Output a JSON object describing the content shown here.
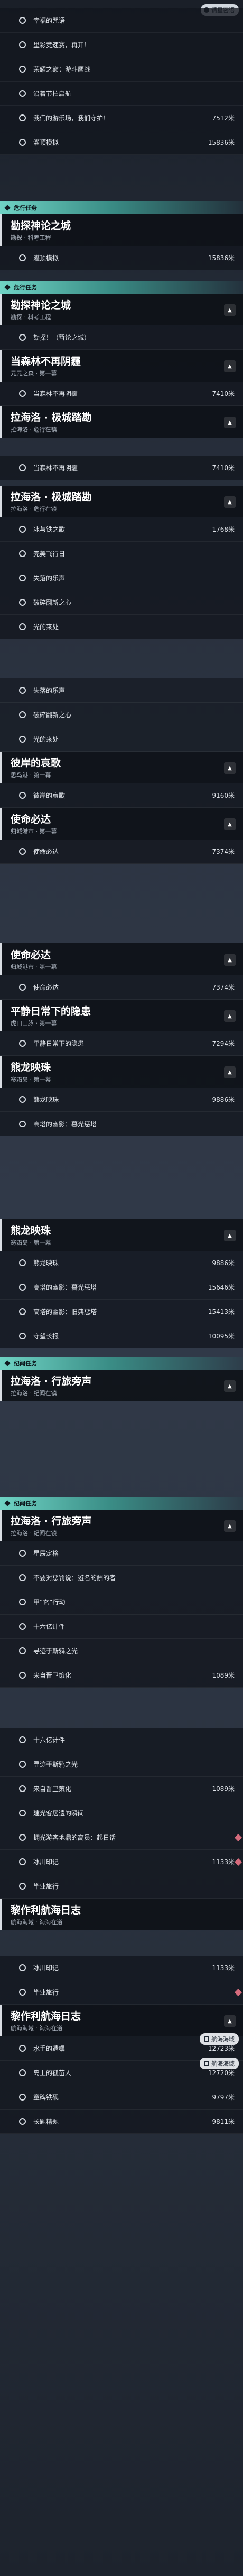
{
  "top_button": "请星密语",
  "block1": {
    "steps": [
      {
        "label": "幸福的咒语",
        "dist": ""
      },
      {
        "label": "里彩竞速赛，再开！",
        "dist": ""
      },
      {
        "label": "荣耀之巅：游斗鏖战",
        "dist": ""
      },
      {
        "label": "沿着节拍启航",
        "dist": ""
      },
      {
        "label": "我们的游乐场，我们守护！",
        "dist": "7512米"
      },
      {
        "label": "灌顶模拟",
        "dist": "15836米"
      }
    ]
  },
  "block2": {
    "header": "危行任务",
    "quest_title": "勘探神论之城",
    "quest_sub": "勘探 · 科考工程",
    "steps": [
      {
        "label": "灌顶模拟",
        "dist": "15836米"
      }
    ]
  },
  "block3": {
    "header": "危行任务",
    "quest_title": "勘探神论之城",
    "quest_sub": "勘探 · 科考工程",
    "steps": [
      {
        "label": "勘探！（暂论之城）",
        "dist": ""
      }
    ],
    "quest2_title": "当森林不再阴霾",
    "quest2_sub": "元元之森 · 第一幕",
    "steps2": [
      {
        "label": "当森林不再阴霾",
        "dist": "7410米"
      }
    ],
    "quest3_title": "拉海洛 · 极城踏勘",
    "quest3_sub": "拉海洛 · 危行在镇"
  },
  "block4": {
    "steps": [
      {
        "label": "当森林不再阴霾",
        "dist": "7410米"
      }
    ],
    "quest_title": "拉海洛 · 极城踏勘",
    "quest_sub": "拉海洛 · 危行在镇",
    "steps2": [
      {
        "label": "冰与铁之歌",
        "dist": "1768米"
      },
      {
        "label": "完美飞行日",
        "dist": ""
      },
      {
        "label": "失落的乐声",
        "dist": ""
      },
      {
        "label": "破碎翻新之心",
        "dist": ""
      },
      {
        "label": "光的来处",
        "dist": ""
      }
    ]
  },
  "block5": {
    "steps": [
      {
        "label": "失落的乐声",
        "dist": ""
      },
      {
        "label": "破碎翻新之心",
        "dist": ""
      },
      {
        "label": "光的来处",
        "dist": ""
      }
    ],
    "quest_title": "彼岸的哀歌",
    "quest_sub": "思鸟港 · 第一幕",
    "steps2": [
      {
        "label": "彼岸的哀歌",
        "dist": "9160米"
      }
    ],
    "quest2_title": "使命必达",
    "quest2_sub": "归城港市 · 第一幕",
    "steps3": [
      {
        "label": "使命必达",
        "dist": "7374米"
      }
    ]
  },
  "block6": {
    "quest_title": "使命必达",
    "quest_sub": "归城港市 · 第一幕",
    "steps": [
      {
        "label": "使命必达",
        "dist": "7374米"
      }
    ],
    "quest2_title": "平静日常下的隐患",
    "quest2_sub": "虎口山脉 · 第一幕",
    "steps2": [
      {
        "label": "平静日常下的隐患",
        "dist": "7294米"
      }
    ],
    "quest3_title": "熊龙映珠",
    "quest3_sub": "寒霜岛 · 第一幕",
    "steps3": [
      {
        "label": "熊龙映珠",
        "dist": "9886米"
      },
      {
        "label": "高塔的幽影：暮光惩塔",
        "dist": ""
      }
    ]
  },
  "block7": {
    "quest_title": "熊龙映珠",
    "quest_sub": "寒霜岛 · 第一幕",
    "steps": [
      {
        "label": "熊龙映珠",
        "dist": "9886米"
      },
      {
        "label": "高塔的幽影：暮光惩塔",
        "dist": "15646米"
      },
      {
        "label": "高塔的幽影：旧典惩塔",
        "dist": "15413米"
      },
      {
        "label": "守望长报",
        "dist": "10095米"
      }
    ],
    "header": "纪闻任务",
    "quest2_title": "拉海洛 · 行旅旁声",
    "quest2_sub": "拉海洛 · 纪闻在镇"
  },
  "block8": {
    "header": "纪闻任务",
    "quest_title": "拉海洛 · 行旅旁声",
    "quest_sub": "拉海洛 · 纪闻在镇",
    "steps": [
      {
        "label": "星辰定格",
        "dist": ""
      },
      {
        "label": "不要对惩罚说：避名的酬的者",
        "dist": ""
      },
      {
        "label": "甲“玄”行动",
        "dist": ""
      },
      {
        "label": "十六亿计件",
        "dist": ""
      },
      {
        "label": "寻迹于斯鸦之光",
        "dist": ""
      },
      {
        "label": "来自晋卫策化",
        "dist": "1089米"
      }
    ]
  },
  "block9": {
    "steps": [
      {
        "label": "十六亿计件",
        "dist": ""
      },
      {
        "label": "寻迹于斯鸦之光",
        "dist": ""
      },
      {
        "label": "来自晋卫策化",
        "dist": "1089米"
      },
      {
        "label": "建光客居遗的瞬间",
        "dist": ""
      },
      {
        "label": "拥光游客地鼎的高员：起日话",
        "dist": ""
      },
      {
        "label": "冰川印记",
        "dist": "1133米"
      },
      {
        "label": "毕业旅行",
        "dist": ""
      }
    ],
    "quest_title": "黎作利航海日志",
    "quest_sub": "航海海域 · 海海在道"
  },
  "block10": {
    "steps": [
      {
        "label": "冰川印记",
        "dist": "1133米"
      },
      {
        "label": "毕业旅行",
        "dist": ""
      }
    ],
    "quest_title": "黎作利航海日志",
    "quest_sub": "航海海域 · 海海在道",
    "steps2": [
      {
        "label": "水手的遗嘱",
        "dist": "12723米"
      },
      {
        "label": "岛上的孤苗人",
        "dist": "12720米"
      },
      {
        "label": "童碑铁砚",
        "dist": "9797米"
      },
      {
        "label": "长题精题",
        "dist": "9811米"
      }
    ],
    "corner_btn": "航海海域"
  },
  "colors": {
    "accent": "#6fd3c4",
    "gem": "#d56b7c"
  }
}
